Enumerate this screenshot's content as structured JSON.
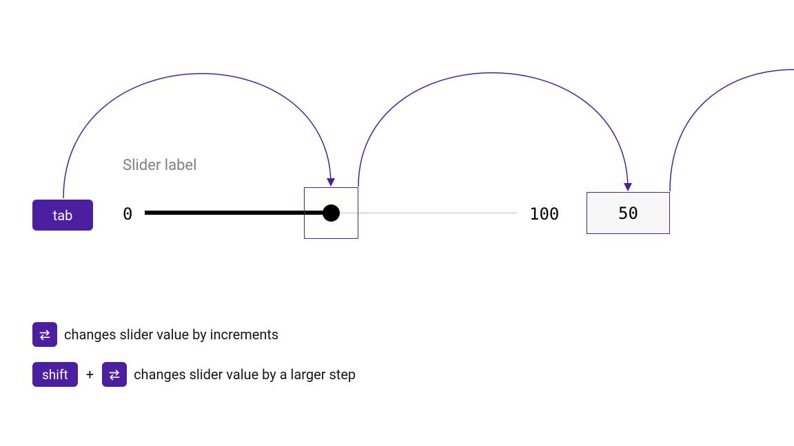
{
  "keys": {
    "tab": "tab",
    "shift": "shift",
    "plus": "+"
  },
  "slider": {
    "label": "Slider label",
    "min": "0",
    "max": "100",
    "value": "50"
  },
  "legend": {
    "line1": "changes slider value by increments",
    "line2": "changes slider value by a larger step"
  },
  "colors": {
    "accent": "#4c1ea0"
  }
}
